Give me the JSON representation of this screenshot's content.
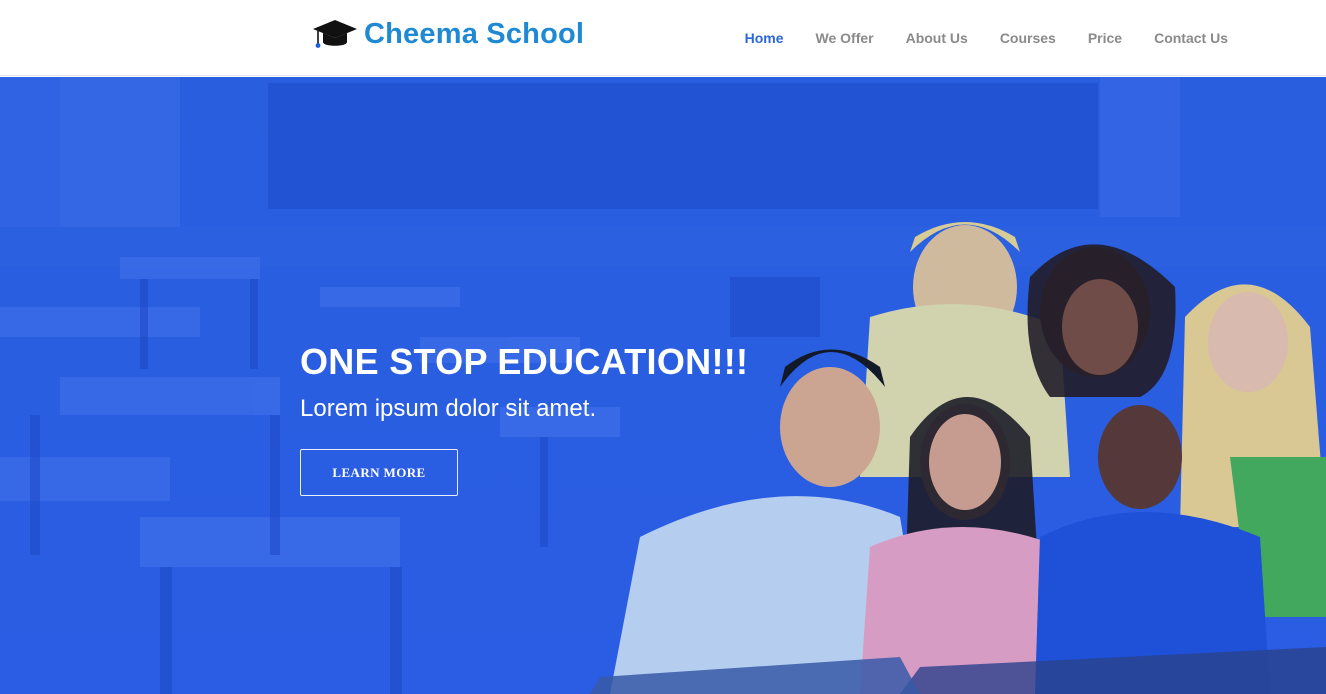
{
  "brand": {
    "name": "Cheema School",
    "icon": "graduation-cap-icon",
    "color": "#1f8ad3"
  },
  "nav": {
    "items": [
      {
        "label": "Home",
        "active": true
      },
      {
        "label": "We Offer",
        "active": false
      },
      {
        "label": "About Us",
        "active": false
      },
      {
        "label": "Courses",
        "active": false
      },
      {
        "label": "Price",
        "active": false
      },
      {
        "label": "Contact Us",
        "active": false
      }
    ],
    "active_color": "#2a67d8",
    "inactive_color": "#8a8a8a"
  },
  "hero": {
    "title": "ONE STOP EDUCATION!!!",
    "subtitle": "Lorem ipsum dolor sit amet.",
    "button_label": "LEARN MORE",
    "overlay_color": "#2657da"
  }
}
